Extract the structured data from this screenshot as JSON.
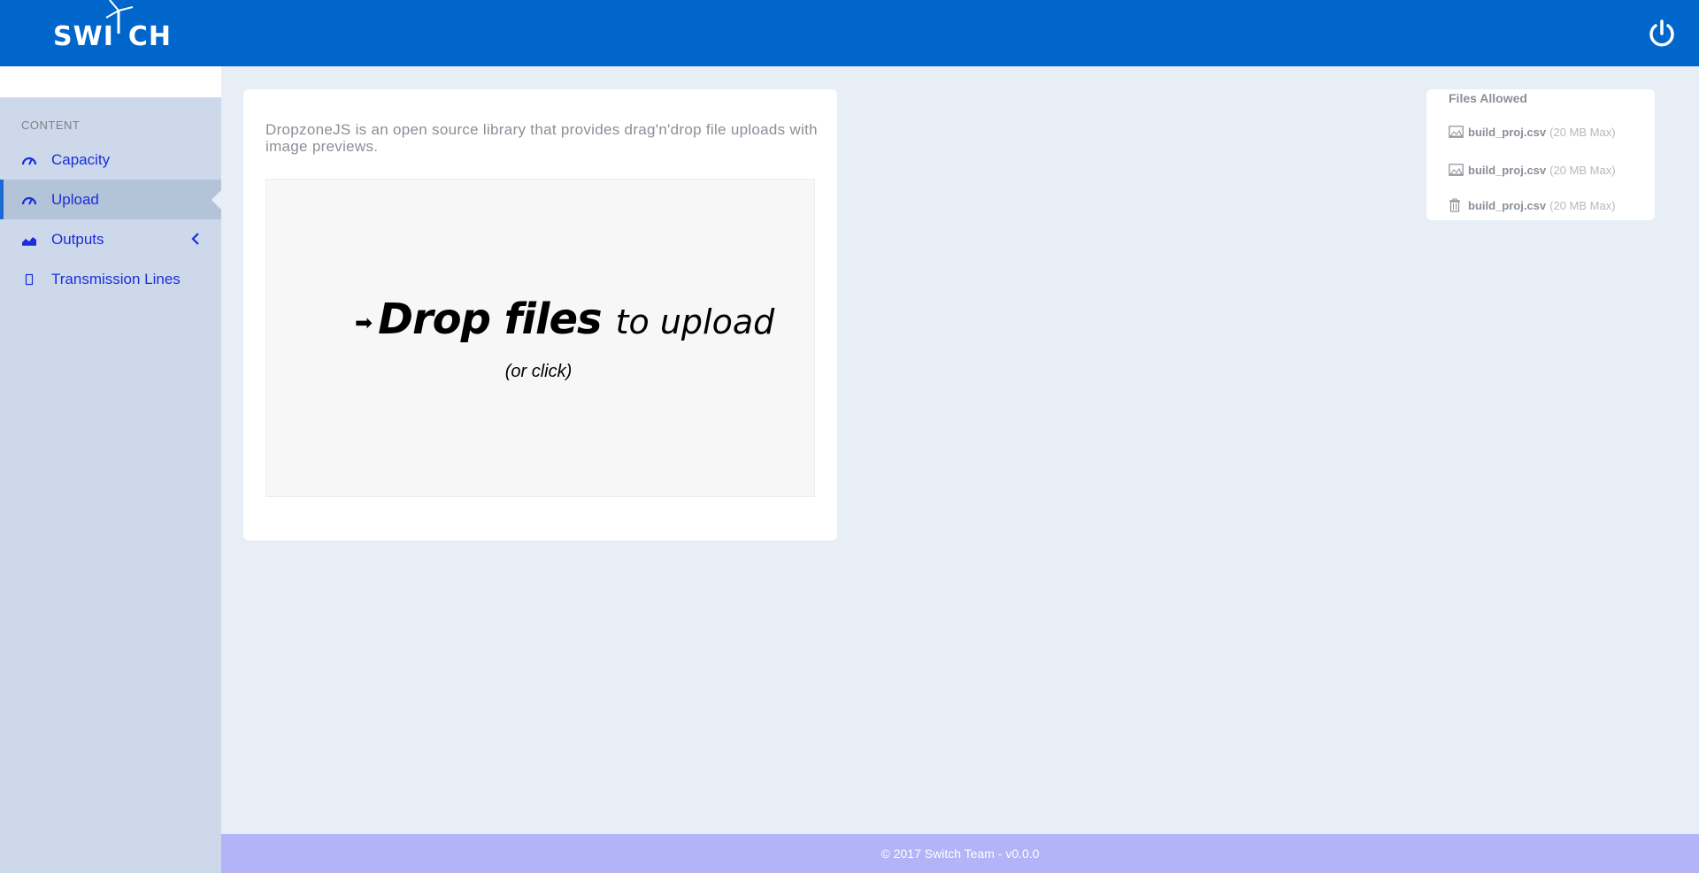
{
  "app": {
    "logo_text": "SWI CH"
  },
  "sidebar": {
    "header": "CONTENT",
    "items": [
      {
        "label": "Capacity",
        "icon": "dashboard-gauge-icon"
      },
      {
        "label": "Upload",
        "icon": "dashboard-gauge-icon",
        "active": true
      },
      {
        "label": "Outputs",
        "icon": "area-chart-icon"
      },
      {
        "label": "Transmission Lines",
        "icon": "unknown-glyph-icon"
      }
    ]
  },
  "main": {
    "description": "DropzoneJS is an open source library that provides drag'n'drop file uploads with image previews.",
    "dropzone": {
      "strong": "Drop files",
      "light": "to upload",
      "sub": "(or click)"
    }
  },
  "files_allowed": {
    "title": "Files Allowed",
    "items": [
      {
        "name": "build_proj.csv",
        "max": "(20 MB Max)",
        "icon": "image-icon"
      },
      {
        "name": "build_proj.csv",
        "max": "(20 MB Max)",
        "icon": "image-icon"
      },
      {
        "name": "build_proj.csv",
        "max": "(20 MB Max)",
        "icon": "trash-icon"
      }
    ]
  },
  "footer": {
    "text": "© 2017 Switch Team - v0.0.0"
  },
  "colors": {
    "topbar": "#0066cc",
    "sidebar": "#cdd9ea",
    "active_item": "#b4c4d8",
    "nav_text": "#1a2fd8",
    "footer": "#b3b3f8"
  }
}
